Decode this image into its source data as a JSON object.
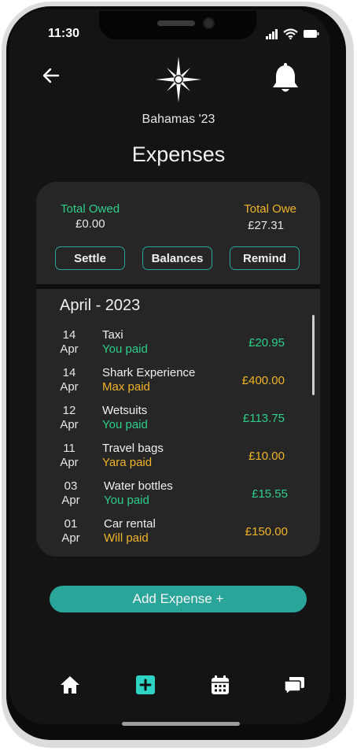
{
  "status_bar": {
    "time": "11:30"
  },
  "header": {
    "trip_name": "Bahamas '23",
    "page_title": "Expenses"
  },
  "summary": {
    "owed_label": "Total Owed",
    "owed_value": "£0.00",
    "owe_label": "Total Owe",
    "owe_value": "£27.31",
    "buttons": [
      "Settle",
      "Balances",
      "Remind"
    ]
  },
  "expenses": {
    "month": "April - 2023",
    "items": [
      {
        "day": "14",
        "month": "Apr",
        "title": "Taxi",
        "payer": "You paid",
        "amount": "£20.95",
        "color": "#2ecf8a"
      },
      {
        "day": "14",
        "month": "Apr",
        "title": "Shark Experience",
        "payer": "Max paid",
        "amount": "£400.00",
        "color": "#f0b429"
      },
      {
        "day": "12",
        "month": "Apr",
        "title": "Wetsuits",
        "payer": "You paid",
        "amount": "£113.75",
        "color": "#2ecf8a"
      },
      {
        "day": "11",
        "month": "Apr",
        "title": "Travel bags",
        "payer": "Yara paid",
        "amount": "£10.00",
        "color": "#f0b429"
      },
      {
        "day": "03",
        "month": "Apr",
        "title": "Water bottles",
        "payer": "You paid",
        "amount": "£15.55",
        "color": "#2ecf8a"
      },
      {
        "day": "01",
        "month": "Apr",
        "title": "Car rental",
        "payer": "Will paid",
        "amount": "£150.00",
        "color": "#f0b429"
      }
    ]
  },
  "add_button": {
    "label": "Add Expense +"
  },
  "bottom_nav": {
    "items": [
      {
        "icon": "home-icon"
      },
      {
        "icon": "add-square-icon"
      },
      {
        "icon": "calendar-icon"
      },
      {
        "icon": "chat-icon"
      }
    ]
  },
  "colors": {
    "accent": "#2aa59a",
    "positive": "#2ecf8a",
    "warning": "#f0b429",
    "background": "#141414",
    "card": "#262626"
  }
}
